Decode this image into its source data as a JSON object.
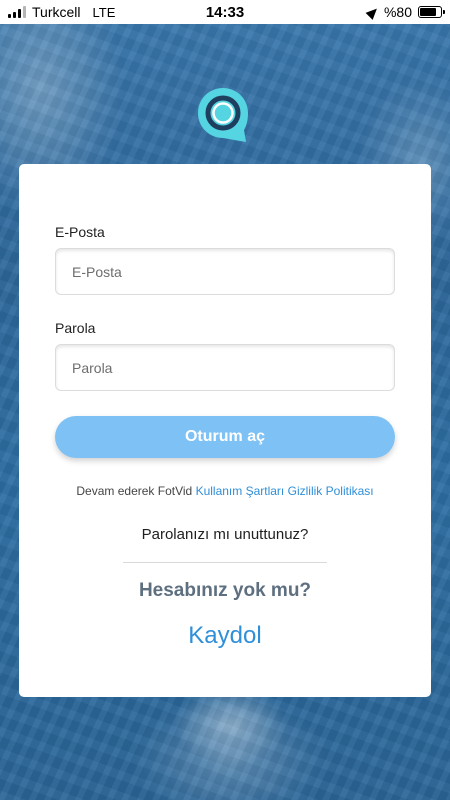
{
  "status_bar": {
    "carrier": "Turkcell",
    "network": "LTE",
    "time": "14:33",
    "battery_text": "%80",
    "battery_level": 0.8
  },
  "icons": {
    "logo": "fotvid-logo-icon",
    "signal": "signal-strength-icon",
    "location": "location-arrow-icon",
    "battery": "battery-icon"
  },
  "colors": {
    "brand": "#4fd0e0",
    "accent": "#2f8fd8",
    "button": "#7ec1f4",
    "background": "#2f6ea3"
  },
  "form": {
    "email_label": "E-Posta",
    "email_placeholder": "E-Posta",
    "email_value": "",
    "password_label": "Parola",
    "password_placeholder": "Parola",
    "password_value": "",
    "login_button": "Oturum aç"
  },
  "terms": {
    "prefix": "Devam ederek FotVid",
    "terms_link": "Kullanım Şartları",
    "privacy_link": "Gizlilik Politikası"
  },
  "forgot_password": "Parolanızı mı unuttunuz?",
  "no_account": "Hesabınız yok mu?",
  "signup": "Kaydol"
}
